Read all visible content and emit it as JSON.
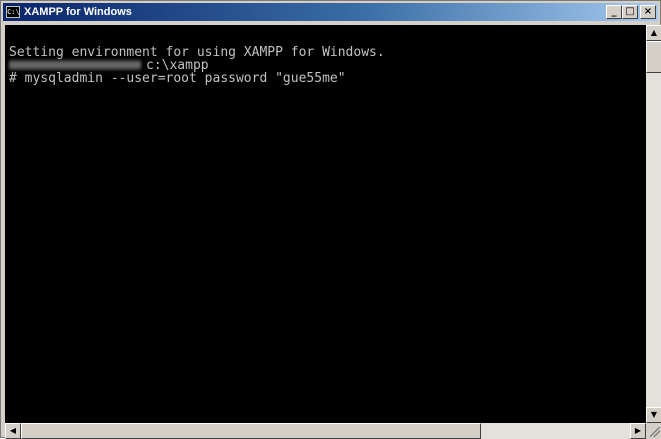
{
  "window": {
    "title": "XAMPP for Windows",
    "icon_glyph": "C:\\",
    "icon": "console-icon"
  },
  "title_buttons": {
    "minimize": "_",
    "maximize": "□",
    "close": "×"
  },
  "console": {
    "line1": "Setting environment for using XAMPP for Windows.",
    "line2": "c:\\xampp",
    "line3": "# mysqladmin --user=root password \"gue55me\""
  },
  "scrollbar": {
    "up": "▲",
    "down": "▼",
    "left": "◀",
    "right": "▶"
  },
  "colors": {
    "console_bg": "#000000",
    "console_text": "#c0c0c0",
    "titlebar_start": "#0a246a",
    "titlebar_end": "#a6caf0"
  }
}
